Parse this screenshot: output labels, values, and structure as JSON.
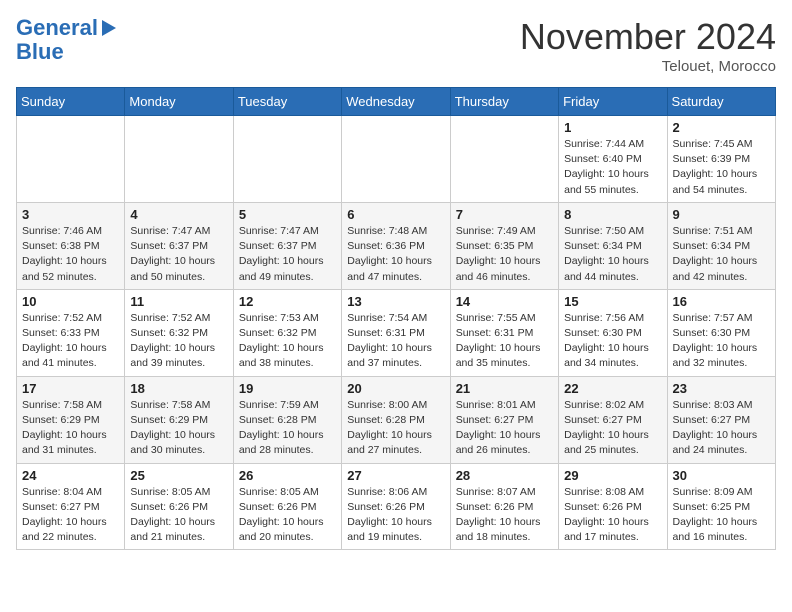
{
  "header": {
    "logo_line1": "General",
    "logo_line2": "Blue",
    "month_title": "November 2024",
    "location": "Telouet, Morocco"
  },
  "days_of_week": [
    "Sunday",
    "Monday",
    "Tuesday",
    "Wednesday",
    "Thursday",
    "Friday",
    "Saturday"
  ],
  "weeks": [
    [
      {
        "day": "",
        "info": ""
      },
      {
        "day": "",
        "info": ""
      },
      {
        "day": "",
        "info": ""
      },
      {
        "day": "",
        "info": ""
      },
      {
        "day": "",
        "info": ""
      },
      {
        "day": "1",
        "info": "Sunrise: 7:44 AM\nSunset: 6:40 PM\nDaylight: 10 hours and 55 minutes."
      },
      {
        "day": "2",
        "info": "Sunrise: 7:45 AM\nSunset: 6:39 PM\nDaylight: 10 hours and 54 minutes."
      }
    ],
    [
      {
        "day": "3",
        "info": "Sunrise: 7:46 AM\nSunset: 6:38 PM\nDaylight: 10 hours and 52 minutes."
      },
      {
        "day": "4",
        "info": "Sunrise: 7:47 AM\nSunset: 6:37 PM\nDaylight: 10 hours and 50 minutes."
      },
      {
        "day": "5",
        "info": "Sunrise: 7:47 AM\nSunset: 6:37 PM\nDaylight: 10 hours and 49 minutes."
      },
      {
        "day": "6",
        "info": "Sunrise: 7:48 AM\nSunset: 6:36 PM\nDaylight: 10 hours and 47 minutes."
      },
      {
        "day": "7",
        "info": "Sunrise: 7:49 AM\nSunset: 6:35 PM\nDaylight: 10 hours and 46 minutes."
      },
      {
        "day": "8",
        "info": "Sunrise: 7:50 AM\nSunset: 6:34 PM\nDaylight: 10 hours and 44 minutes."
      },
      {
        "day": "9",
        "info": "Sunrise: 7:51 AM\nSunset: 6:34 PM\nDaylight: 10 hours and 42 minutes."
      }
    ],
    [
      {
        "day": "10",
        "info": "Sunrise: 7:52 AM\nSunset: 6:33 PM\nDaylight: 10 hours and 41 minutes."
      },
      {
        "day": "11",
        "info": "Sunrise: 7:52 AM\nSunset: 6:32 PM\nDaylight: 10 hours and 39 minutes."
      },
      {
        "day": "12",
        "info": "Sunrise: 7:53 AM\nSunset: 6:32 PM\nDaylight: 10 hours and 38 minutes."
      },
      {
        "day": "13",
        "info": "Sunrise: 7:54 AM\nSunset: 6:31 PM\nDaylight: 10 hours and 37 minutes."
      },
      {
        "day": "14",
        "info": "Sunrise: 7:55 AM\nSunset: 6:31 PM\nDaylight: 10 hours and 35 minutes."
      },
      {
        "day": "15",
        "info": "Sunrise: 7:56 AM\nSunset: 6:30 PM\nDaylight: 10 hours and 34 minutes."
      },
      {
        "day": "16",
        "info": "Sunrise: 7:57 AM\nSunset: 6:30 PM\nDaylight: 10 hours and 32 minutes."
      }
    ],
    [
      {
        "day": "17",
        "info": "Sunrise: 7:58 AM\nSunset: 6:29 PM\nDaylight: 10 hours and 31 minutes."
      },
      {
        "day": "18",
        "info": "Sunrise: 7:58 AM\nSunset: 6:29 PM\nDaylight: 10 hours and 30 minutes."
      },
      {
        "day": "19",
        "info": "Sunrise: 7:59 AM\nSunset: 6:28 PM\nDaylight: 10 hours and 28 minutes."
      },
      {
        "day": "20",
        "info": "Sunrise: 8:00 AM\nSunset: 6:28 PM\nDaylight: 10 hours and 27 minutes."
      },
      {
        "day": "21",
        "info": "Sunrise: 8:01 AM\nSunset: 6:27 PM\nDaylight: 10 hours and 26 minutes."
      },
      {
        "day": "22",
        "info": "Sunrise: 8:02 AM\nSunset: 6:27 PM\nDaylight: 10 hours and 25 minutes."
      },
      {
        "day": "23",
        "info": "Sunrise: 8:03 AM\nSunset: 6:27 PM\nDaylight: 10 hours and 24 minutes."
      }
    ],
    [
      {
        "day": "24",
        "info": "Sunrise: 8:04 AM\nSunset: 6:27 PM\nDaylight: 10 hours and 22 minutes."
      },
      {
        "day": "25",
        "info": "Sunrise: 8:05 AM\nSunset: 6:26 PM\nDaylight: 10 hours and 21 minutes."
      },
      {
        "day": "26",
        "info": "Sunrise: 8:05 AM\nSunset: 6:26 PM\nDaylight: 10 hours and 20 minutes."
      },
      {
        "day": "27",
        "info": "Sunrise: 8:06 AM\nSunset: 6:26 PM\nDaylight: 10 hours and 19 minutes."
      },
      {
        "day": "28",
        "info": "Sunrise: 8:07 AM\nSunset: 6:26 PM\nDaylight: 10 hours and 18 minutes."
      },
      {
        "day": "29",
        "info": "Sunrise: 8:08 AM\nSunset: 6:26 PM\nDaylight: 10 hours and 17 minutes."
      },
      {
        "day": "30",
        "info": "Sunrise: 8:09 AM\nSunset: 6:25 PM\nDaylight: 10 hours and 16 minutes."
      }
    ]
  ]
}
